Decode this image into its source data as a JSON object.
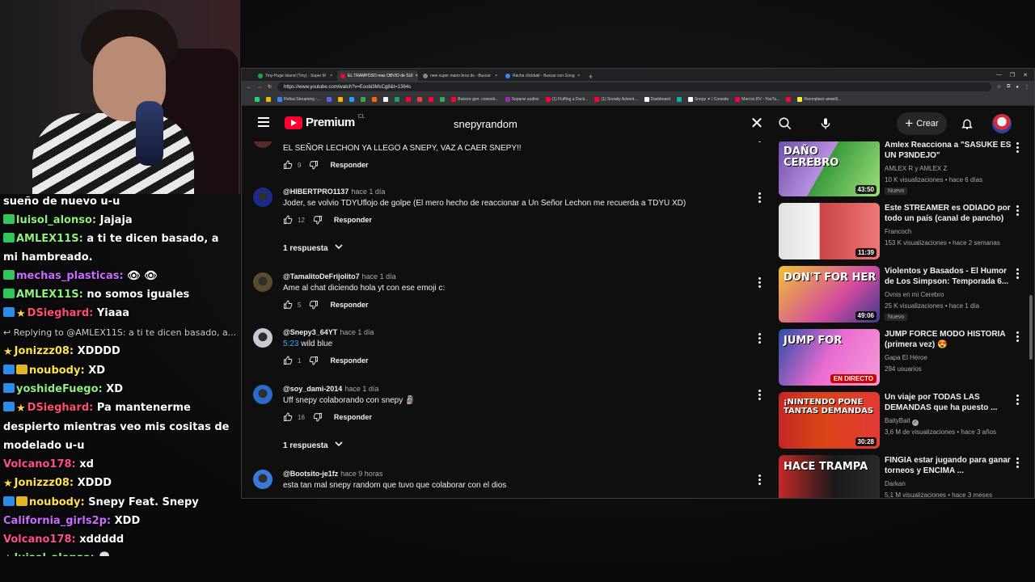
{
  "chat": [
    {
      "badges": [],
      "user": "",
      "msg": "sueño de nuevo u-u",
      "color": "#ffffff"
    },
    {
      "badges": [
        "green"
      ],
      "user": "luisol_alonso:",
      "msg": "Jajaja",
      "color": "#8ef07a"
    },
    {
      "badges": [
        "green"
      ],
      "user": "AMLEX11S:",
      "msg": "a ti te dicen basado, a mi hambreado.",
      "color": "#8ef07a"
    },
    {
      "badges": [
        "green"
      ],
      "user": "mechas_plasticas:",
      "msg": "👁 👁",
      "color": "#c86bff"
    },
    {
      "badges": [
        "green"
      ],
      "user": "AMLEX11S:",
      "msg": "no somos iguales",
      "color": "#8ef07a"
    },
    {
      "badges": [
        "blue",
        "star"
      ],
      "user": "DSieghard:",
      "msg": "Yiaaa",
      "color": "#ff4d6d"
    },
    {
      "badges": [],
      "user": "",
      "msg": "",
      "color": "#ffffff",
      "reply": "↩ Replying to @AMLEX11S: a ti te dicen basado, a..."
    },
    {
      "badges": [
        "star"
      ],
      "user": "Jonizzz08:",
      "msg": "XDDDD",
      "color": "#ffe14a"
    },
    {
      "badges": [
        "blue",
        "crown"
      ],
      "user": "noubody:",
      "msg": "XD",
      "color": "#ffe14a"
    },
    {
      "badges": [
        "blue"
      ],
      "user": "yoshideFuego:",
      "msg": "XD",
      "color": "#8ef07a"
    },
    {
      "badges": [
        "blue",
        "star"
      ],
      "user": "DSieghard:",
      "msg": "Pa mantenerme despierto mientras veo mis cositas de modelado u-u",
      "color": "#ff4d6d"
    },
    {
      "badges": [],
      "user": "Volcano178:",
      "msg": "xd",
      "color": "#ff4d8a"
    },
    {
      "badges": [
        "star"
      ],
      "user": "Jonizzz08:",
      "msg": "XDDD",
      "color": "#ffe14a"
    },
    {
      "badges": [
        "blue",
        "crown"
      ],
      "user": "noubody:",
      "msg": "Snepy Feat. Snepy",
      "color": "#ffe14a"
    },
    {
      "badges": [],
      "user": "California_girls2p:",
      "msg": "XDD",
      "color": "#c86bff"
    },
    {
      "badges": [],
      "user": "Volcano178:",
      "msg": "xddddd",
      "color": "#ff4d8a"
    },
    {
      "badges": [
        "star"
      ],
      "user": "luisol_alonso:",
      "msg": "💀",
      "color": "#8ef07a"
    }
  ],
  "browser": {
    "tabs": [
      {
        "label": "Tiny-Huge Island (Tiny) - Super M",
        "color": "#2ea043",
        "active": false
      },
      {
        "label": "EL TRAMPOSO mas OBVIO de SUI",
        "color": "#ff0033",
        "active": true
      },
      {
        "label": "new super mario bros ds - Buscar",
        "color": "#888888",
        "active": false
      },
      {
        "label": "Racha clickbait - Buscar con Goog",
        "color": "#4285f4",
        "active": false
      }
    ],
    "new_tab": "+",
    "window_controls": [
      "—",
      "❐",
      "✕"
    ],
    "url": "https://www.youtube.com/watch?v=Eoobi3MsCg8&t=1364s",
    "bookmarks": [
      {
        "label": "",
        "color": "#25d366"
      },
      {
        "label": "",
        "color": "#f4b400"
      },
      {
        "label": "Relkai Streaming -...",
        "color": "#3b82f6"
      },
      {
        "label": "",
        "color": "#5865f2"
      },
      {
        "label": "",
        "color": "#f4b400"
      },
      {
        "label": "",
        "color": "#1da1f2"
      },
      {
        "label": "",
        "color": "#34a853"
      },
      {
        "label": "",
        "color": "#ff6600"
      },
      {
        "label": "",
        "color": "#ffffff"
      },
      {
        "label": "",
        "color": "#1aa260"
      },
      {
        "label": "",
        "color": "#ff0033"
      },
      {
        "label": "",
        "color": "#ea4335"
      },
      {
        "label": "",
        "color": "#ff0033"
      },
      {
        "label": "",
        "color": "#34a853"
      },
      {
        "label": "Buturre gen. conexió...",
        "color": "#ff0033"
      },
      {
        "label": "Separar audios",
        "color": "#9c27b0"
      },
      {
        "label": "(1) Fluffing a Duck...",
        "color": "#ff0033"
      },
      {
        "label": "(1) Sneaky Advent...",
        "color": "#ff0033"
      },
      {
        "label": "Dashboard",
        "color": "#ffffff"
      },
      {
        "label": "",
        "color": "#00b3a4"
      },
      {
        "label": "Snepy ✦ | Console",
        "color": "#ffffff"
      },
      {
        "label": "Marcos RV - YouTu...",
        "color": "#ff0033"
      },
      {
        "label": "",
        "color": "#ff0033"
      },
      {
        "label": "Reemplazo amarill...",
        "color": "#ffeb3b"
      }
    ]
  },
  "yt": {
    "logo_text": "Premium",
    "region": "CL",
    "search_value": "snepyrandom",
    "search_clear": "✕",
    "create_label": "Crear",
    "create_plus": "+"
  },
  "comments": [
    {
      "author": "",
      "time": "",
      "text": "EL SEÑOR LECHON YA LLEGO A SNEPY, VAZ A CAER SNEPY!!",
      "likes": "9",
      "reply_label": "Responder",
      "avatar": "#5a2a2a"
    },
    {
      "author": "@HIBERTPRO1137",
      "time": "hace 1 día",
      "text": "Joder, se volvio TDYUflojo de golpe (El mero hecho de reaccionar a Un Señor Lechon me recuerda a TDYU XD)",
      "likes": "12",
      "reply_label": "Responder",
      "avatar": "#1e2a8a",
      "replies": "1 respuesta"
    },
    {
      "author": "@TamalitoDeFrijolito7",
      "time": "hace 1 día",
      "text": "Ame al chat diciendo hola yt con ese emoji c:",
      "likes": "5",
      "reply_label": "Responder",
      "avatar": "#5b4a2e"
    },
    {
      "author": "@Snepy3_64YT",
      "time": "hace 1 día",
      "ts": "5:23",
      "text": "wild blue",
      "likes": "1",
      "reply_label": "Responder",
      "avatar": "#c9c9d6"
    },
    {
      "author": "@soy_dami-2014",
      "time": "hace 1 día",
      "text": "Uff snepy colaborando con snepy 🗿",
      "likes": "16",
      "reply_label": "Responder",
      "avatar": "#2a6ac9",
      "replies": "1 respuesta"
    },
    {
      "author": "@Bootsito-je1fz",
      "time": "hace 9 horas",
      "text": "esta tan mal snepy random que tuvo que colaborar con el dios",
      "likes": "",
      "reply_label": "",
      "avatar": "#3a7ad9"
    }
  ],
  "related": [
    {
      "title": "Amlex Reacciona a \"SASUKE ES UN P3NDEJO\"",
      "channel": "AMLEX R y AMLEX Z",
      "meta": "10 K visualizaciones • hace 6 días",
      "badge": "Nuevo",
      "duration": "43:50",
      "thumb_bg": "linear-gradient(120deg,#6e4fa8,#b88fe0 45%,#3c9a3c 46%,#9be07a)",
      "thumb_text": "DAÑO CEREBRO",
      "live": false,
      "verified": false
    },
    {
      "title": "Este STREAMER es ODIADO por todo un país (canal de pancho)",
      "channel": "Francoch",
      "meta": "153 K visualizaciones • hace 2 semanas",
      "badge": "",
      "duration": "11:39",
      "thumb_bg": "linear-gradient(90deg,#e0e0e0,#f5f5f5 40%,#c44 41%,#e77)",
      "thumb_text": "",
      "live": false,
      "verified": false
    },
    {
      "title": "Violentos y Basados - El Humor de Los Simpson: Temporada 6...",
      "channel": "Ovnis en mi Cerebro",
      "meta": "25 K visualizaciones • hace 1 día",
      "badge": "Nuevo",
      "duration": "49:06",
      "thumb_bg": "linear-gradient(135deg,#f2c233,#d34b9e 60%,#3b3b8f)",
      "thumb_text": "DON'T FOR HER",
      "live": false,
      "verified": false
    },
    {
      "title": "JUMP FORCE MODO HISTORIA (primera vez) 😍",
      "channel": "Gapa El Héroe",
      "meta": "294 usuarios",
      "badge": "",
      "duration": "EN DIRECTO",
      "thumb_bg": "linear-gradient(120deg,#2a4ea8,#e96bd0 50%,#f59ad8)",
      "thumb_text": "JUMP FOR",
      "live": true,
      "verified": false
    },
    {
      "title": "Un viaje por TODAS LAS DEMANDAS que ha puesto ...",
      "channel": "BaityBait",
      "meta": "3,6 M de visualizaciones • hace 3 años",
      "badge": "",
      "duration": "30:28",
      "thumb_bg": "linear-gradient(90deg,#c62828,#d84315 40%,#e53935)",
      "thumb_text": "¡NINTENDO PONE TANTAS DEMANDAS",
      "live": false,
      "verified": true
    },
    {
      "title": "FINGIA estar jugando para ganar torneos y ENCIMA ...",
      "channel": "Darkan",
      "meta": "5,1 M visualizaciones • hace 3 meses",
      "badge": "",
      "duration": "",
      "thumb_bg": "linear-gradient(90deg,#c62828,#1a1a1a 55%,#2a2a2a)",
      "thumb_text": "HACE TRAMPA",
      "live": false,
      "verified": false
    }
  ]
}
